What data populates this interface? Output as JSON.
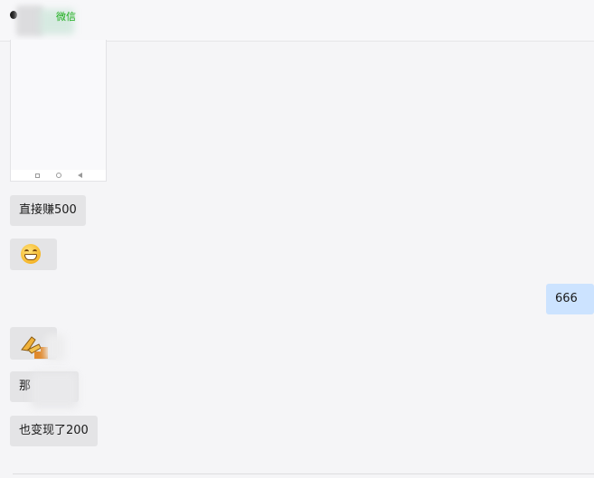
{
  "header": {
    "app_label": "微信"
  },
  "messages": [
    {
      "kind": "image",
      "label": "phone screenshot"
    },
    {
      "kind": "text",
      "sender": "other",
      "text": "直接赚500"
    },
    {
      "kind": "emoji",
      "sender": "other",
      "icon": "grinning-face-icon"
    },
    {
      "kind": "text",
      "sender": "self",
      "text": "666"
    },
    {
      "kind": "sticker",
      "sender": "other",
      "icon": "hand-sticker-icon"
    },
    {
      "kind": "text",
      "sender": "other",
      "text": "那"
    },
    {
      "kind": "text",
      "sender": "other",
      "text": "也变现了200"
    }
  ],
  "colors": {
    "background": "#f5f5f7",
    "bubble_other": "#e4e4e6",
    "bubble_self": "#cce3ff",
    "wechat_green": "#1aad19"
  }
}
